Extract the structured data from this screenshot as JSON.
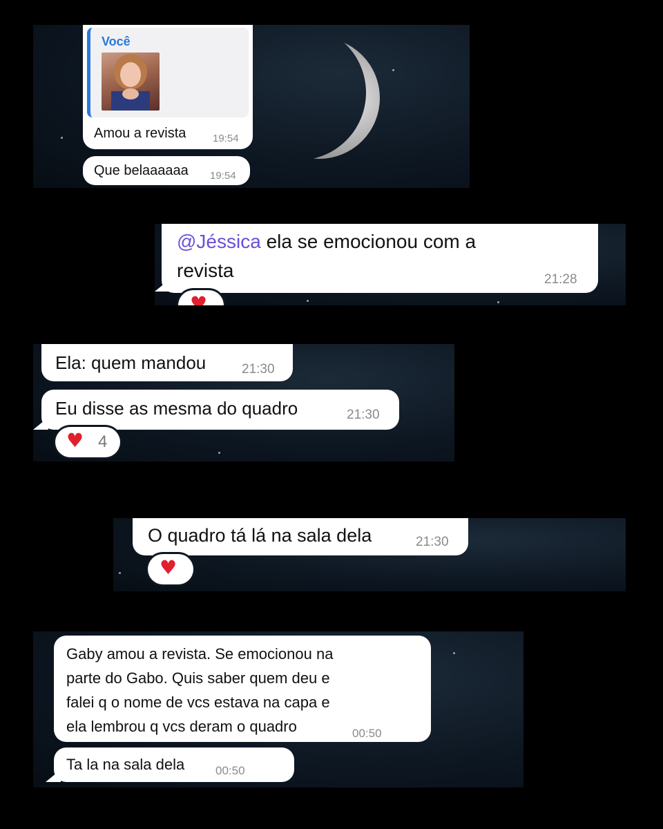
{
  "colors": {
    "background": "#000000",
    "bubble": "#ffffff",
    "mention": "#6b4fd8",
    "quote_bar": "#2a79d8",
    "heart": "#e0202e"
  },
  "panel1": {
    "reply_author": "Você",
    "reply_thumbnail": "photo-thumbnail",
    "messages": [
      {
        "text": "Amou a revista",
        "time": "19:54"
      },
      {
        "text": "Que belaaaaaa",
        "time": "19:54"
      }
    ]
  },
  "panel2": {
    "mention": "@Jéssica",
    "text_line1": " ela se emocionou com a",
    "text_line2": "revista",
    "time": "21:28",
    "reaction_icon": "heart-icon"
  },
  "panel3": {
    "messages": [
      {
        "text": "Ela: quem mandou",
        "time": "21:30"
      },
      {
        "text": "Eu disse as mesma do quadro",
        "time": "21:30"
      }
    ],
    "reaction_icon": "heart-icon",
    "reaction_count": "4"
  },
  "panel4": {
    "text": "O quadro tá lá na sala dela",
    "time": "21:30",
    "reaction_icon": "heart-icon"
  },
  "panel5": {
    "messages": [
      {
        "lines": [
          "Gaby amou a revista. Se emocionou na",
          "parte do Gabo. Quis saber quem deu e",
          "falei q o nome de vcs estava na capa e",
          "ela lembrou q vcs deram o quadro"
        ],
        "time": "00:50"
      },
      {
        "text": "Ta la na sala dela",
        "time": "00:50"
      }
    ]
  }
}
